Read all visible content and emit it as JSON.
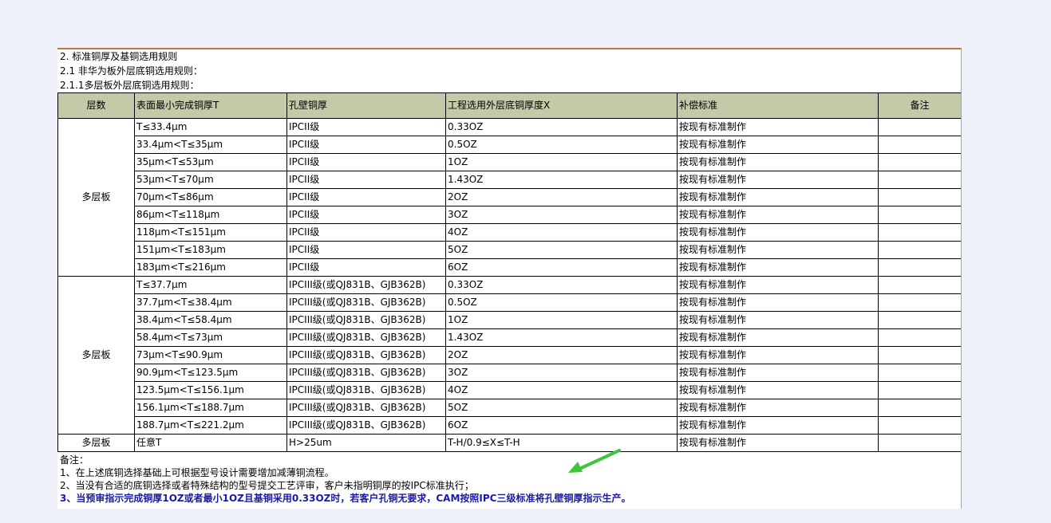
{
  "headings": [
    "2. 标准铜厚及基铜选用规则",
    "2.1 非华为板外层底铜选用规则：",
    "2.1.1多层板外层底铜选用规则："
  ],
  "columns": [
    "层数",
    "表面最小完成铜厚T",
    "孔壁铜厚",
    "工程选用外层底铜厚度X",
    "补偿标准",
    "备注"
  ],
  "groups": [
    {
      "layer": "多层板",
      "rows": [
        [
          "T≤33.4μm",
          "IPCII级",
          "0.33OZ",
          "按现有标准制作",
          ""
        ],
        [
          "33.4μm<T≤35μm",
          "IPCII级",
          "0.5OZ",
          "按现有标准制作",
          ""
        ],
        [
          "35μm<T≤53μm",
          "IPCII级",
          "1OZ",
          "按现有标准制作",
          ""
        ],
        [
          "53μm<T≤70μm",
          "IPCII级",
          "1.43OZ",
          "按现有标准制作",
          ""
        ],
        [
          "70μm<T≤86μm",
          "IPCII级",
          "2OZ",
          "按现有标准制作",
          ""
        ],
        [
          "86μm<T≤118μm",
          "IPCII级",
          "3OZ",
          "按现有标准制作",
          ""
        ],
        [
          "118μm<T≤151μm",
          "IPCII级",
          "4OZ",
          "按现有标准制作",
          ""
        ],
        [
          "151μm<T≤183μm",
          "IPCII级",
          "5OZ",
          "按现有标准制作",
          ""
        ],
        [
          "183μm<T≤216μm",
          "IPCII级",
          "6OZ",
          "按现有标准制作",
          ""
        ]
      ]
    },
    {
      "layer": "多层板",
      "rows": [
        [
          "T≤37.7μm",
          "IPCIII级(或QJ831B、GJB362B)",
          "0.33OZ",
          "按现有标准制作",
          ""
        ],
        [
          "37.7μm<T≤38.4μm",
          "IPCIII级(或QJ831B、GJB362B)",
          "0.5OZ",
          "按现有标准制作",
          ""
        ],
        [
          "38.4μm<T≤58.4μm",
          "IPCIII级(或QJ831B、GJB362B)",
          "1OZ",
          "按现有标准制作",
          ""
        ],
        [
          "58.4μm<T≤73μm",
          "IPCIII级(或QJ831B、GJB362B)",
          "1.43OZ",
          "按现有标准制作",
          ""
        ],
        [
          "73μm<T≤90.9μm",
          "IPCIII级(或QJ831B、GJB362B)",
          "2OZ",
          "按现有标准制作",
          ""
        ],
        [
          "90.9μm<T≤123.5μm",
          "IPCIII级(或QJ831B、GJB362B)",
          "3OZ",
          "按现有标准制作",
          ""
        ],
        [
          "123.5μm<T≤156.1μm",
          "IPCIII级(或QJ831B、GJB362B)",
          "4OZ",
          "按现有标准制作",
          ""
        ],
        [
          "156.1μm<T≤188.7μm",
          "IPCIII级(或QJ831B、GJB362B)",
          "5OZ",
          "按现有标准制作",
          ""
        ],
        [
          "188.7μm<T≤221.2μm",
          "IPCIII级(或QJ831B、GJB362B)",
          "6OZ",
          "按现有标准制作",
          ""
        ]
      ]
    },
    {
      "layer": "多层板",
      "rows": [
        [
          "任意T",
          "H>25um",
          "T-H/0.9≤X≤T-H",
          "按现有标准制作",
          ""
        ]
      ]
    }
  ],
  "remarks": {
    "title": "备注：",
    "line1": "1、在上述底铜选择基础上可根据型号设计需要增加减薄铜流程。",
    "line2": "2、当没有合适的底铜选择或者特殊结构的型号提交工艺评审，客户未指明铜厚的按IPC标准执行；",
    "line3": "3、当预审指示完成铜厚1OZ或者最小1OZ且基铜采用0.33OZ时，若客户孔铜无要求，CAM按照IPC三级标准将孔壁铜厚指示生产。"
  },
  "colors": {
    "header_bg": "#c4c9a8",
    "arrow": "#3cc63c",
    "note_blue": "#1a1aa8",
    "page_bg": "#eef1fa"
  }
}
